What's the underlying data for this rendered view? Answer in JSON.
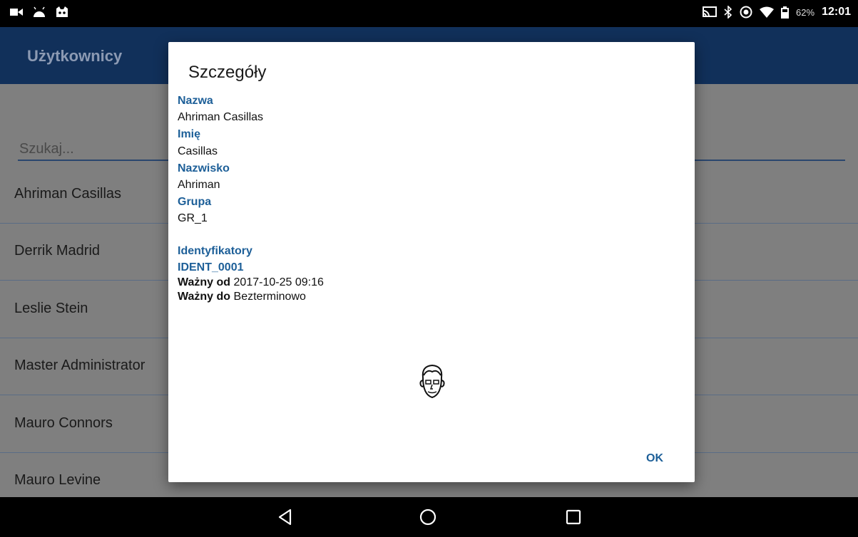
{
  "status_bar": {
    "battery": "62%",
    "time": "12:01",
    "icons_left": [
      "video-camera-icon",
      "android-head-icon",
      "cat-face-icon"
    ],
    "icons_right": [
      "cast-icon",
      "bluetooth-icon",
      "do-not-disturb-icon",
      "wifi-icon",
      "battery-icon"
    ]
  },
  "app_bar": {
    "title": "Użytkownicy"
  },
  "search": {
    "placeholder": "Szukaj..."
  },
  "users": [
    "Ahriman Casillas",
    "Derrik Madrid",
    "Leslie Stein",
    "Master Administrator",
    "Mauro Connors",
    "Mauro Levine"
  ],
  "dialog": {
    "title": "Szczegóły",
    "name_label": "Nazwa",
    "name_value": "Ahriman Casillas",
    "first_name_label": "Imię",
    "first_name_value": "Casillas",
    "last_name_label": "Nazwisko",
    "last_name_value": "Ahriman",
    "group_label": "Grupa",
    "group_value": "GR_1",
    "identifiers_label": "Identyfikatory",
    "ident_id": "IDENT_0001",
    "valid_from_label": "Ważny od",
    "valid_from_value": "2017-10-25 09:16",
    "valid_to_label": "Ważny do",
    "valid_to_value": "Bezterminowo",
    "ok_label": "OK"
  },
  "colors": {
    "accent": "#1d5f98",
    "app_bar": "#1f4b8e",
    "dim_overlay": "#7f7f7f"
  }
}
